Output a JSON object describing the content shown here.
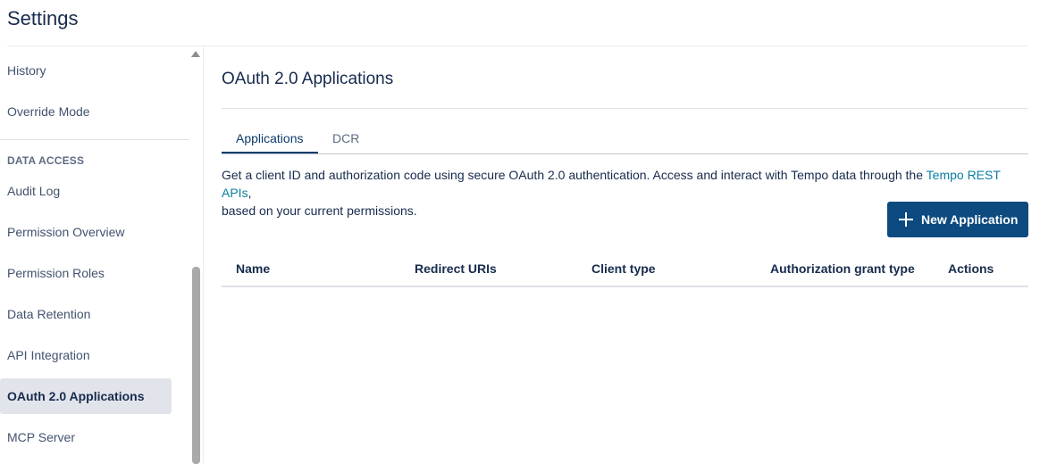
{
  "page": {
    "title": "Settings"
  },
  "sidebar": {
    "items_top": [
      {
        "label": "History"
      },
      {
        "label": "Override Mode"
      }
    ],
    "section_label": "DATA ACCESS",
    "items": [
      {
        "label": "Audit Log"
      },
      {
        "label": "Permission Overview"
      },
      {
        "label": "Permission Roles"
      },
      {
        "label": "Data Retention"
      },
      {
        "label": "API Integration"
      },
      {
        "label": "OAuth 2.0 Applications",
        "active": true
      },
      {
        "label": "MCP Server"
      }
    ]
  },
  "main": {
    "title": "OAuth 2.0 Applications",
    "tabs": [
      {
        "label": "Applications",
        "active": true
      },
      {
        "label": "DCR"
      }
    ],
    "description_prefix": "Get a client ID and authorization code using secure OAuth 2.0 authentication. Access and interact with Tempo data through the ",
    "description_link": "Tempo REST APIs",
    "description_suffix": ",",
    "description_line2": "based on your current permissions.",
    "new_button_label": "New Application",
    "table": {
      "columns": [
        "Name",
        "Redirect URIs",
        "Client type",
        "Authorization grant type",
        "Actions"
      ]
    }
  },
  "colors": {
    "accent": "#0c4a7f",
    "link": "#0a7ea4",
    "active_nav_bg": "#e2e4ec"
  },
  "icons": {
    "new_button": "plus-icon",
    "scroll": "scroll-up-arrow-icon"
  }
}
